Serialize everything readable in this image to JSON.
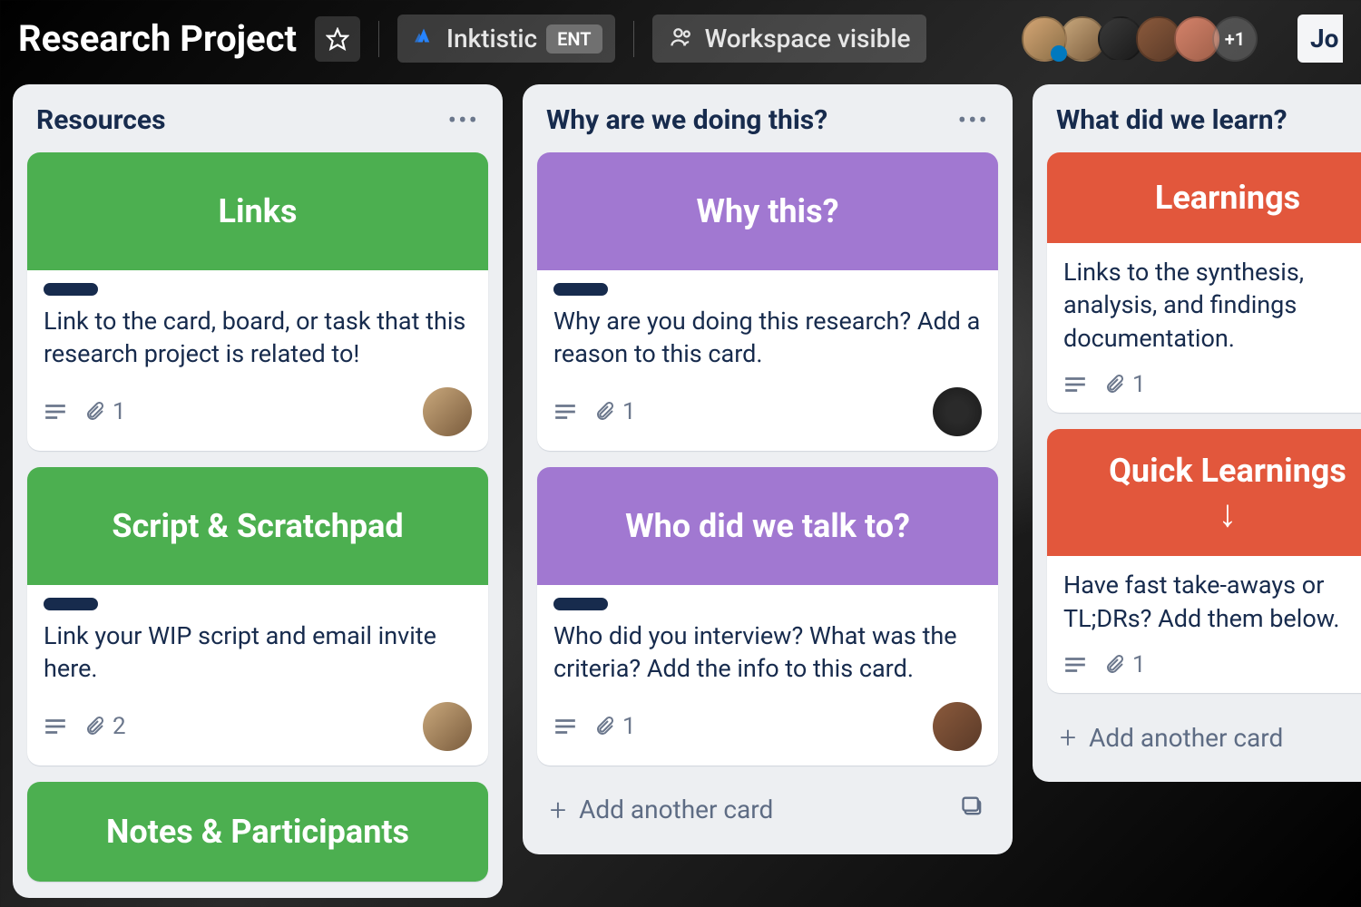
{
  "header": {
    "board_title": "Research Project",
    "org_name": "Inktistic",
    "org_badge": "ENT",
    "visibility": "Workspace visible",
    "avatar_overflow": "+1",
    "tail_text": "Jo"
  },
  "lists": [
    {
      "title": "Resources",
      "cards": [
        {
          "cover_text": "Links",
          "cover_color": "green",
          "text": "Link to the card, board, or task that this research project is related to!",
          "attachments": "1",
          "avatar": "ca1"
        },
        {
          "cover_text": "Script & Scratchpad",
          "cover_color": "green",
          "text": "Link your WIP script and email invite here.",
          "attachments": "2",
          "avatar": "ca1"
        },
        {
          "cover_text": "Notes & Participants",
          "cover_color": "green"
        }
      ]
    },
    {
      "title": "Why are we doing this?",
      "cards": [
        {
          "cover_text": "Why this?",
          "cover_color": "purple",
          "text": "Why are you doing this research? Add a reason to this card.",
          "attachments": "1",
          "avatar": "ca2"
        },
        {
          "cover_text": "Who did we talk to?",
          "cover_color": "purple",
          "text": "Who did you interview? What was the criteria? Add the info to this card.",
          "attachments": "1",
          "avatar": "ca3"
        }
      ],
      "add_card": "Add another card"
    },
    {
      "title": "What did we learn?",
      "cards": [
        {
          "cover_text": "Learnings",
          "cover_color": "red",
          "text": "Links to the synthesis, analysis, and findings documentation.",
          "attachments": "1"
        },
        {
          "cover_text": "Quick Learnings",
          "cover_color": "red",
          "arrow": true,
          "text": "Have fast take-aways or TL;DRs? Add them below.",
          "attachments": "1"
        }
      ],
      "add_card": "Add another card"
    }
  ]
}
